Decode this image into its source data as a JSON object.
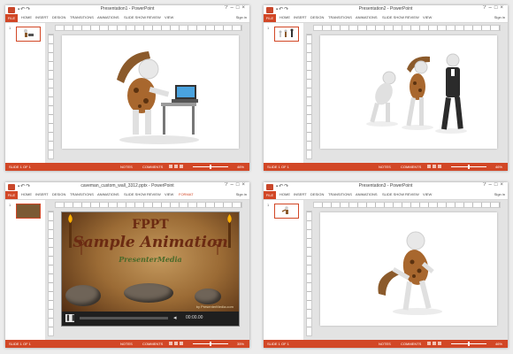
{
  "ribbon_tabs": [
    "FILE",
    "HOME",
    "INSERT",
    "DESIGN",
    "TRANSITIONS",
    "ANIMATIONS",
    "SLIDE SHOW",
    "REVIEW",
    "VIEW"
  ],
  "ribbon_tabs_with_format": [
    "FILE",
    "HOME",
    "INSERT",
    "DESIGN",
    "TRANSITIONS",
    "ANIMATIONS",
    "SLIDE SHOW",
    "REVIEW",
    "VIEW",
    "FORMAT"
  ],
  "sign_in": "Sign in",
  "status": {
    "slide_label": "SLIDE 1 OF 1",
    "notes": "NOTES",
    "comments": "COMMENTS"
  },
  "windows": [
    {
      "title": "Presentation1 - PowerPoint",
      "slide_num": "1",
      "zoom": "46%"
    },
    {
      "title": "Presentation2 - PowerPoint",
      "slide_num": "1",
      "zoom": "46%"
    },
    {
      "title": "caveman_custom_wall_3312.pptx - PowerPoint",
      "slide_num": "1",
      "zoom": "35%",
      "slide": {
        "title_line1": "FPPT",
        "title_line2": "Sample Animation",
        "title_line3": "PresenterMedia",
        "credit": "by PresenterMedia.com",
        "time": "00:00.00"
      }
    },
    {
      "title": "Presentation3 - PowerPoint",
      "slide_num": "1",
      "zoom": "46%"
    }
  ],
  "colors": {
    "accent": "#d24726"
  }
}
